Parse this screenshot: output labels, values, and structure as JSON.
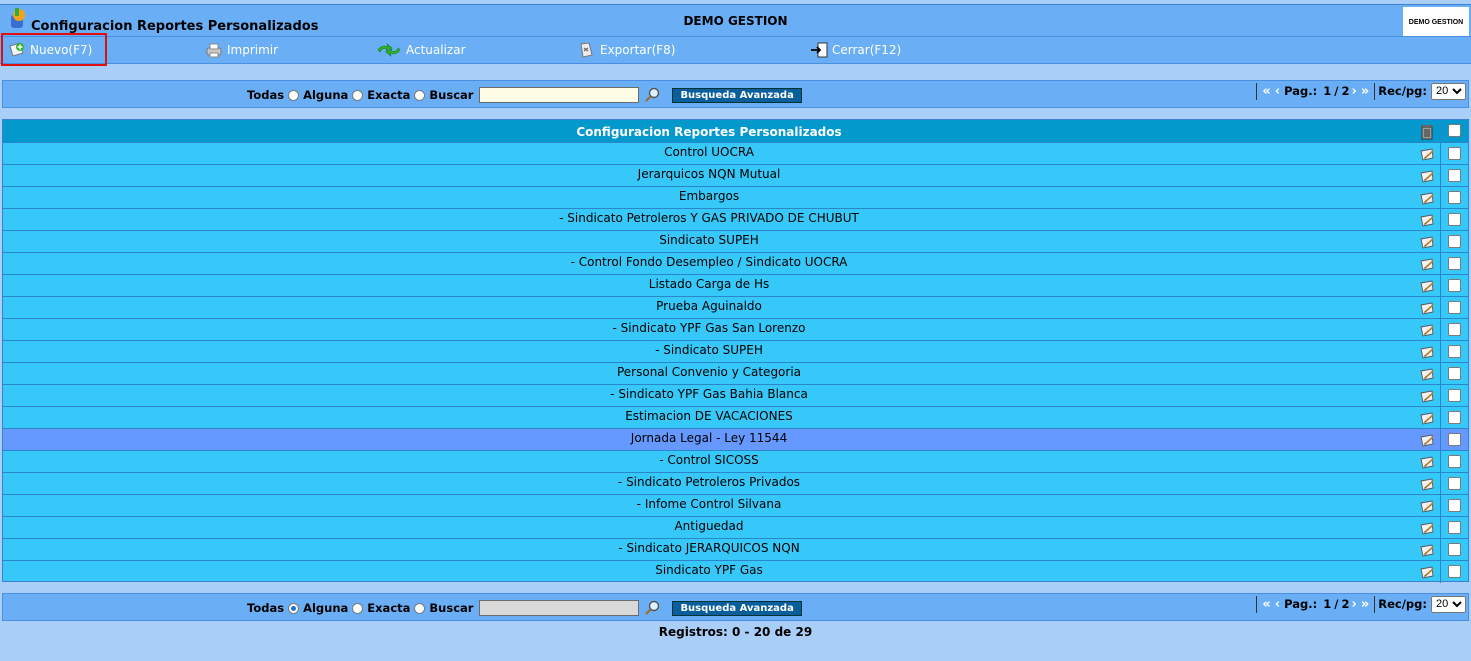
{
  "window": {
    "app_title": "Configuracion Reportes Personalizados",
    "center_title": "DEMO GESTION",
    "company_logo_text": "DEMO GESTION"
  },
  "toolbar": {
    "nuevo": "Nuevo(F7)",
    "imprimir": "Imprimir",
    "actualizar": "Actualizar",
    "exportar": "Exportar(F8)",
    "cerrar": "Cerrar(F12)"
  },
  "search_top": {
    "opt_todas": "Todas",
    "opt_alguna": "Alguna",
    "opt_exacta": "Exacta",
    "buscar_label": "Buscar",
    "value": "",
    "advanced": "Busqueda Avanzada",
    "selected": "none"
  },
  "search_bottom": {
    "opt_todas": "Todas",
    "opt_alguna": "Alguna",
    "opt_exacta": "Exacta",
    "buscar_label": "Buscar",
    "value": "",
    "advanced": "Busqueda Avanzada",
    "selected": "Todas"
  },
  "pager": {
    "pag_label": "Pag.:",
    "current": "1",
    "slash": "/",
    "total": "2",
    "recpg_label": "Rec/pg:",
    "recpg_value": "20"
  },
  "table": {
    "title": "Configuracion Reportes Personalizados",
    "selected_index": 13,
    "rows": [
      "Control UOCRA",
      "Jerarquicos NQN Mutual",
      "Embargos",
      "- Sindicato Petroleros Y GAS PRIVADO DE CHUBUT",
      "Sindicato SUPEH",
      "- Control Fondo Desempleo / Sindicato UOCRA",
      "Listado Carga de Hs",
      "Prueba Aguinaldo",
      "- Sindicato YPF Gas San Lorenzo",
      "- Sindicato SUPEH",
      "Personal Convenio y Categoria",
      "- Sindicato YPF Gas Bahia Blanca",
      "Estimacion DE VACACIONES",
      "Jornada Legal - Ley 11544",
      "- Control SICOSS",
      "- Sindicato Petroleros Privados",
      "- Infome Control Silvana",
      "Antiguedad",
      "- Sindicato JERARQUICOS NQN",
      "Sindicato YPF Gas"
    ]
  },
  "footer": {
    "registros": "Registros: 0 - 20 de 29"
  },
  "colors": {
    "bar": "#6aaff5",
    "row": "#35c8f8",
    "header": "#0399cc",
    "selected_row": "#6699ff",
    "background": "#a9cff8"
  }
}
